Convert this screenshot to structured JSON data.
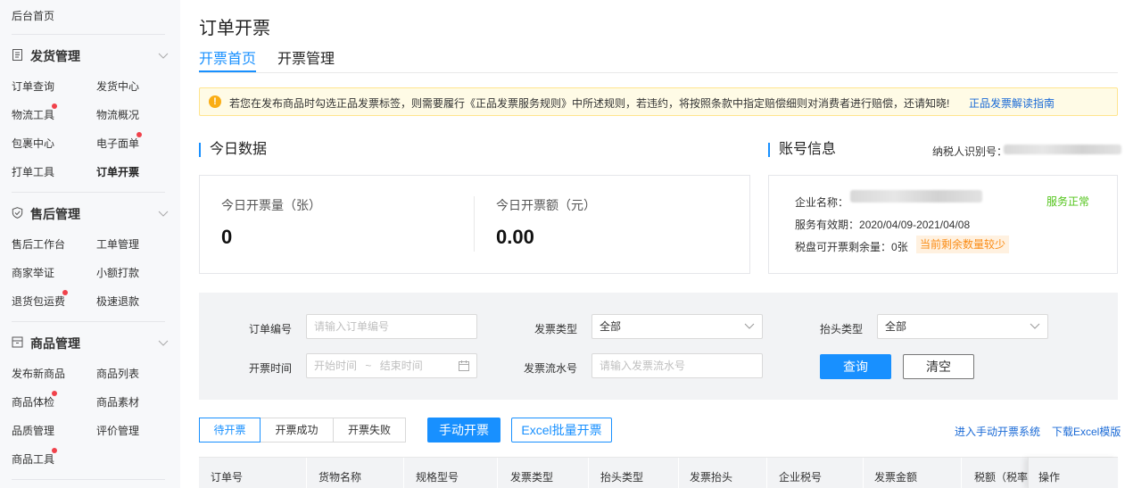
{
  "sidebar": {
    "home": "后台首页",
    "sections": [
      {
        "title": "发货管理",
        "icon": "document-icon",
        "items": [
          "订单查询",
          "发货中心",
          "物流工具",
          "物流概况",
          "包裹中心",
          "电子面单",
          "打单工具",
          "订单开票"
        ]
      },
      {
        "title": "售后管理",
        "icon": "shield-check-icon",
        "items": [
          "售后工作台",
          "工单管理",
          "商家举证",
          "小额打款",
          "退货包运费",
          "极速退款"
        ]
      },
      {
        "title": "商品管理",
        "icon": "box-icon",
        "items": [
          "发布新商品",
          "商品列表",
          "商品体检",
          "商品素材",
          "品质管理",
          "评价管理",
          "商品工具"
        ]
      }
    ],
    "active_item": "订单开票"
  },
  "page": {
    "title": "订单开票",
    "tabs": [
      "开票首页",
      "开票管理"
    ],
    "active_tab": "开票首页"
  },
  "notice": {
    "text": "若您在发布商品时勾选正品发票标签，则需要履行《正品发票服务规则》中所述规则，若违约，将按照条款中指定赔偿细则对消费者进行赔偿，还请知晓!",
    "link": "正品发票解读指南",
    "color": "#faad14"
  },
  "today": {
    "title": "今日数据",
    "count_label": "今日开票量（张）",
    "count_value": "0",
    "amount_label": "今日开票额（元）",
    "amount_value": "0.00"
  },
  "account": {
    "title": "账号信息",
    "tax_id_label": "纳税人识别号：",
    "company_label": "企业名称：",
    "status": "服务正常",
    "validity_label": "服务有效期：",
    "validity_value": "2020/04/09-2021/04/08",
    "remain_label": "税盘可开票剩余量：",
    "remain_value": "0张",
    "remain_tag": "当前剩余数量较少"
  },
  "filter": {
    "order_no_label": "订单编号",
    "order_no_placeholder": "请输入订单编号",
    "invoice_type_label": "发票类型",
    "invoice_type_value": "全部",
    "header_type_label": "抬头类型",
    "header_type_value": "全部",
    "time_label": "开票时间",
    "time_start_placeholder": "开始时间",
    "time_sep": "~",
    "time_end_placeholder": "结束时间",
    "serial_label": "发票流水号",
    "serial_placeholder": "请输入发票流水号",
    "query_button": "查询",
    "clear_button": "清空"
  },
  "status_tabs": [
    "待开票",
    "开票成功",
    "开票失败"
  ],
  "active_status": "待开票",
  "actions": {
    "manual": "手动开票",
    "excel": "Excel批量开票",
    "enter_manual": "进入手动开票系统",
    "download": "下载Excel模版"
  },
  "table": {
    "columns": [
      "订单号",
      "货物名称",
      "规格型号",
      "发票类型",
      "抬头类型",
      "发票抬头",
      "企业税号",
      "发票金额",
      "税额（税率",
      "操作"
    ]
  },
  "colors": {
    "primary": "#1890ff",
    "success": "#52c41a",
    "warning": "#fa8c16",
    "badge": "#f0424b"
  }
}
